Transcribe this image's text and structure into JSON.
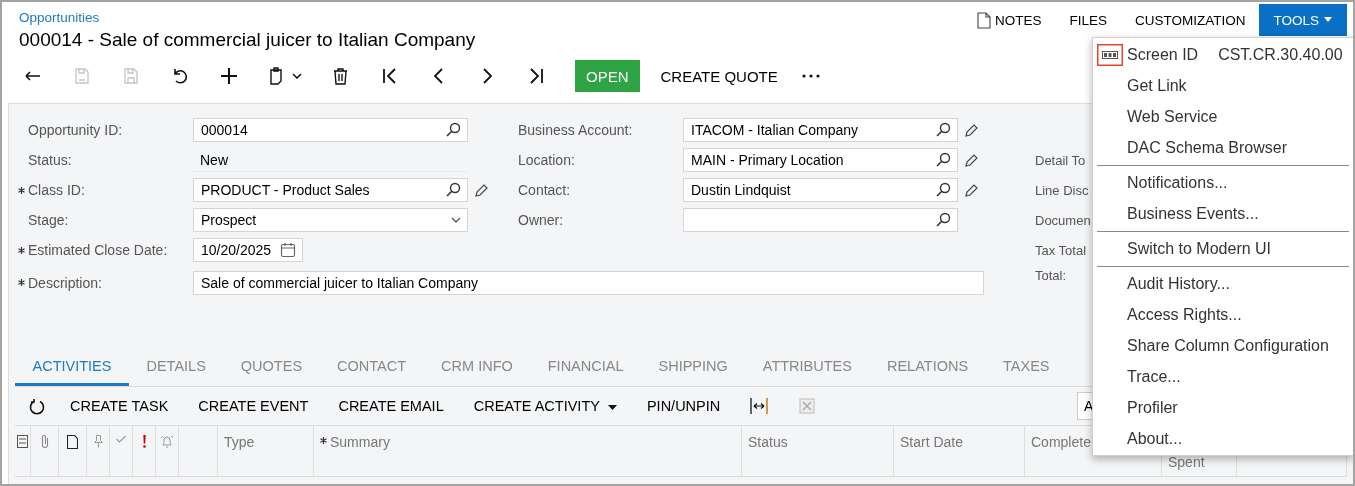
{
  "breadcrumb": "Opportunities",
  "title": "000014 - Sale of commercial juicer to Italian Company",
  "top_actions": [
    {
      "label": "NOTES",
      "kind": "notes",
      "expanded": false
    },
    {
      "label": "FILES",
      "kind": "plain",
      "expanded": false
    },
    {
      "label": "CUSTOMIZATION",
      "kind": "plain",
      "expanded": false
    },
    {
      "label": "TOOLS",
      "kind": "dropdown",
      "expanded": true
    }
  ],
  "toolbar": {
    "icon_buttons": [
      {
        "disabled": false
      },
      {
        "disabled": true
      },
      {
        "disabled": true
      },
      {
        "disabled": false
      },
      {
        "disabled": false
      },
      {
        "disabled": false
      },
      {
        "disabled": false
      },
      {
        "disabled": false
      },
      {
        "disabled": false
      },
      {
        "disabled": false
      },
      {
        "disabled": false
      }
    ],
    "actions": [
      {
        "label": "OPEN",
        "kind": "primary"
      },
      {
        "label": "CREATE QUOTE",
        "kind": "plain"
      }
    ]
  },
  "form": {
    "left": [
      {
        "label": "Opportunity ID:",
        "required": false,
        "kind": "lookup",
        "value": "000014",
        "pencil": false
      },
      {
        "label": "Status:",
        "required": false,
        "kind": "text",
        "value": "New",
        "pencil": false
      },
      {
        "label": "Class ID:",
        "required": true,
        "kind": "lookup",
        "value": "PRODUCT - Product Sales",
        "pencil": true
      },
      {
        "label": "Stage:",
        "required": false,
        "kind": "select",
        "value": "Prospect",
        "pencil": false
      },
      {
        "label": "Estimated Close Date:",
        "required": true,
        "kind": "date",
        "value": "10/20/2025",
        "pencil": false
      }
    ],
    "middle": [
      {
        "label": "Business Account:",
        "required": false,
        "kind": "lookup",
        "value": "ITACOM - Italian Company",
        "pencil": true
      },
      {
        "label": "Location:",
        "required": false,
        "kind": "lookup",
        "value": "MAIN - Primary Location",
        "pencil": true
      },
      {
        "label": "Contact:",
        "required": false,
        "kind": "lookup",
        "value": "Dustin Lindquist",
        "pencil": true
      },
      {
        "label": "Owner:",
        "required": false,
        "kind": "lookup",
        "pencil": false
      }
    ],
    "right_labels": [
      "Detail To",
      "Line Disc",
      "Documen",
      "Tax Total",
      "Total:"
    ],
    "description": {
      "label": "Description:",
      "required": true,
      "value": "Sale of commercial juicer to Italian Company"
    }
  },
  "tabs": [
    {
      "label": "ACTIVITIES",
      "selected": true
    },
    {
      "label": "DETAILS",
      "selected": false
    },
    {
      "label": "QUOTES",
      "selected": false
    },
    {
      "label": "CONTACT",
      "selected": false
    },
    {
      "label": "CRM INFO",
      "selected": false
    },
    {
      "label": "FINANCIAL",
      "selected": false
    },
    {
      "label": "SHIPPING",
      "selected": false
    },
    {
      "label": "ATTRIBUTES",
      "selected": false
    },
    {
      "label": "RELATIONS",
      "selected": false
    },
    {
      "label": "TAXES",
      "selected": false
    }
  ],
  "activity_toolbar": {
    "actions": [
      {
        "label": "CREATE TASK",
        "kind": "plain"
      },
      {
        "label": "CREATE EVENT",
        "kind": "plain"
      },
      {
        "label": "CREATE EMAIL",
        "kind": "plain"
      },
      {
        "label": "CREATE ACTIVITY",
        "kind": "dropdown"
      },
      {
        "label": "PIN/UNPIN",
        "kind": "plain"
      }
    ],
    "search_value": "A"
  },
  "grid": {
    "columns": [
      {
        "label": "Type",
        "required": false
      },
      {
        "label": "Summary",
        "required": true
      },
      {
        "label": "Status",
        "required": false
      },
      {
        "label": "Start Date",
        "required": false
      },
      {
        "label": "Complete",
        "required": false
      },
      {
        "label": "Spent",
        "required": false
      }
    ]
  },
  "tools_menu": {
    "screen_id": {
      "label": "Screen ID",
      "value": "CST.CR.30.40.00"
    },
    "groups": [
      [
        "Get Link",
        "Web Service",
        "DAC Schema Browser"
      ],
      [
        "Notifications...",
        "Business Events..."
      ],
      [
        "Switch to Modern UI"
      ],
      [
        "Audit History...",
        "Access Rights...",
        "Share Column Configuration",
        "Trace...",
        "Profiler",
        "About..."
      ]
    ]
  }
}
